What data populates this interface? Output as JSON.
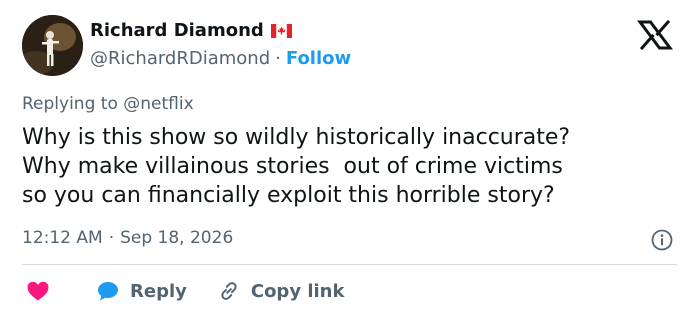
{
  "author": {
    "display_name": "Richard Diamond",
    "handle": "@RichardRDiamond",
    "separator": "·",
    "follow_label": "Follow",
    "flag": "canada-flag-icon"
  },
  "reply_context": {
    "prefix": "Replying to ",
    "mention": "@netflix"
  },
  "tweet": {
    "text": "Why is this show so wildly historically inaccurate?\nWhy make villainous stories  out of crime victims\nso you can financially exploit this horrible story?",
    "time": "12:12 AM",
    "separator": "·",
    "date": "Sep 18, 2026"
  },
  "actions": {
    "like_icon": "heart-icon",
    "reply_label": "Reply",
    "copy_link_label": "Copy link"
  },
  "colors": {
    "accent": "#1d9bf0",
    "like": "#f91880",
    "secondary_text": "#536471",
    "divider": "#cfd9de"
  }
}
